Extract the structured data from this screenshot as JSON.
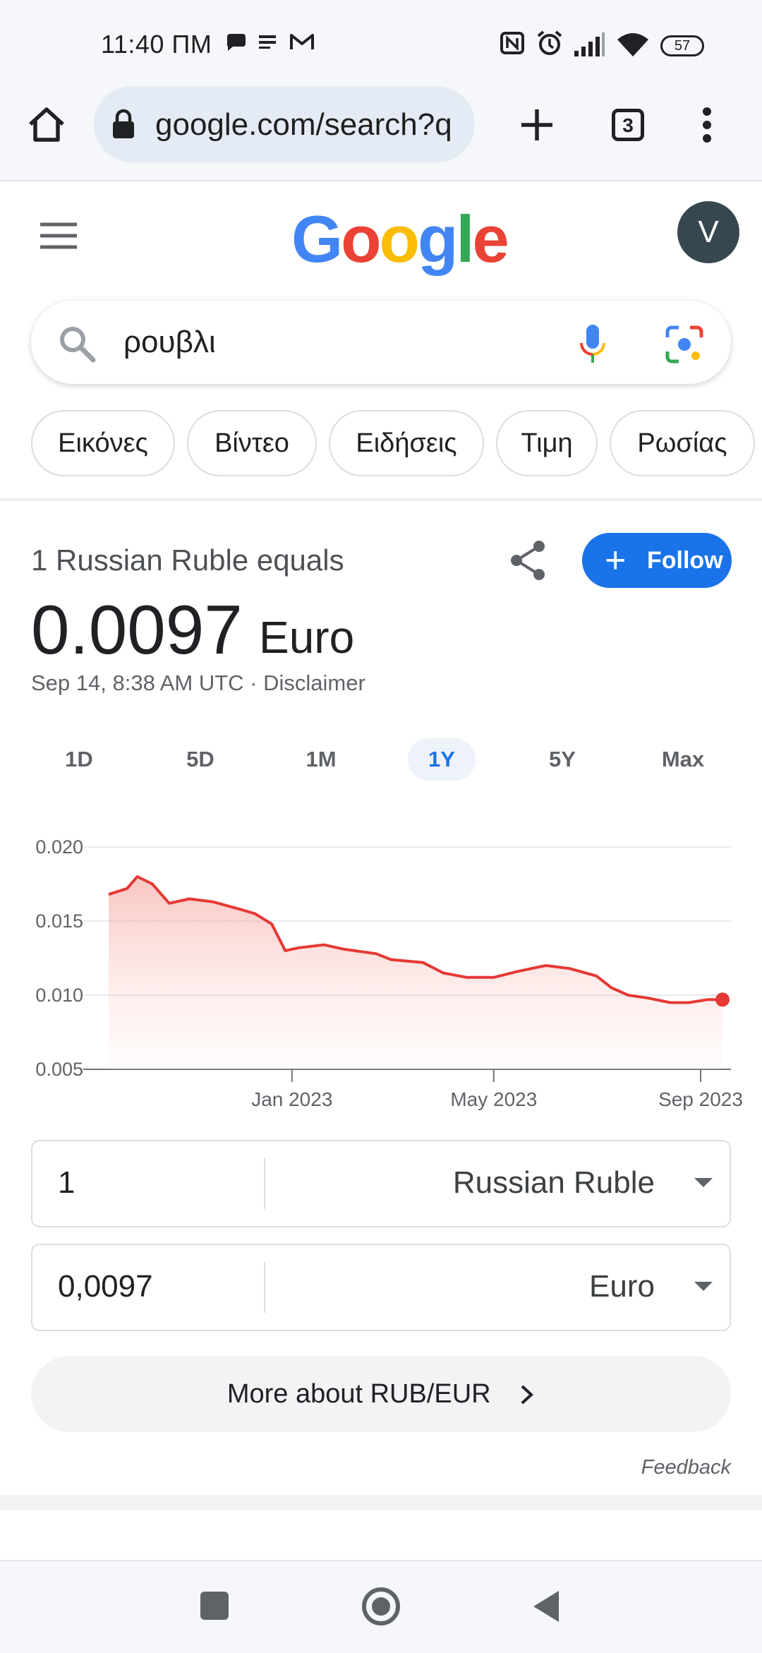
{
  "status_bar": {
    "time": "11:40 ΠΜ",
    "battery": "57",
    "icons": [
      "chat-bubble-icon",
      "info-icon",
      "gmail-icon",
      "nfc-icon",
      "alarm-icon",
      "signal-icon",
      "wifi-icon",
      "battery-icon"
    ]
  },
  "browser": {
    "url": "google.com/search?q",
    "tab_count": "3"
  },
  "google": {
    "logo": [
      "G",
      "o",
      "o",
      "g",
      "l",
      "e"
    ],
    "logo_colors": [
      "#4285F4",
      "#EA4335",
      "#FBBC05",
      "#4285F4",
      "#34A853",
      "#EA4335"
    ],
    "avatar_letter": "V",
    "query": "ρουβλι"
  },
  "chips": [
    "Εικόνες",
    "Βίντεο",
    "Ειδήσεις",
    "Τιμη",
    "Ρωσίας"
  ],
  "converter": {
    "equals_text": "1 Russian Ruble equals",
    "rate": "0.0097",
    "unit": "Euro",
    "timestamp": "Sep 14, 8:38 AM UTC · Disclaimer",
    "follow_label": "Follow",
    "ranges": [
      "1D",
      "5D",
      "1M",
      "1Y",
      "5Y",
      "Max"
    ],
    "selected_range": "1Y",
    "from_amount": "1",
    "from_currency": "Russian Ruble",
    "to_amount": "0,0097",
    "to_currency": "Euro",
    "more_label": "More about RUB/EUR",
    "feedback": "Feedback"
  },
  "chart_data": {
    "type": "area",
    "y_ticks": [
      "0.020",
      "0.015",
      "0.010",
      "0.005"
    ],
    "ylim": [
      0.005,
      0.02
    ],
    "x_ticks": [
      {
        "label": "Jan 2023",
        "date": "2023-01-01"
      },
      {
        "label": "May 2023",
        "date": "2023-05-01"
      },
      {
        "label": "Sep 2023",
        "date": "2023-09-01"
      }
    ],
    "grid": true,
    "color": "#e53935",
    "x": [
      "2022-09-14",
      "2022-09-25",
      "2022-10-01",
      "2022-10-10",
      "2022-10-20",
      "2022-11-01",
      "2022-11-15",
      "2022-12-01",
      "2022-12-10",
      "2022-12-20",
      "2022-12-28",
      "2023-01-05",
      "2023-01-20",
      "2023-02-01",
      "2023-02-20",
      "2023-03-01",
      "2023-03-20",
      "2023-04-01",
      "2023-04-15",
      "2023-05-01",
      "2023-05-15",
      "2023-06-01",
      "2023-06-15",
      "2023-07-01",
      "2023-07-10",
      "2023-07-20",
      "2023-08-01",
      "2023-08-14",
      "2023-08-25",
      "2023-09-05",
      "2023-09-14"
    ],
    "y": [
      0.0168,
      0.0172,
      0.018,
      0.0175,
      0.0162,
      0.0165,
      0.0163,
      0.0158,
      0.0155,
      0.0148,
      0.013,
      0.0132,
      0.0134,
      0.0131,
      0.0128,
      0.0124,
      0.0122,
      0.0115,
      0.0112,
      0.0112,
      0.0116,
      0.012,
      0.0118,
      0.0113,
      0.0105,
      0.01,
      0.0098,
      0.0095,
      0.0095,
      0.0097,
      0.0097
    ]
  },
  "nav": {
    "icons": [
      "recents-square-icon",
      "home-circle-icon",
      "back-triangle-icon"
    ]
  }
}
